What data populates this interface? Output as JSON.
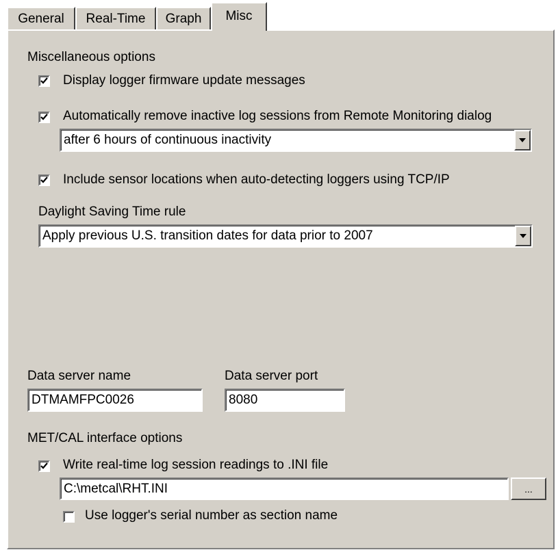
{
  "tabs": [
    {
      "label": "General"
    },
    {
      "label": "Real-Time"
    },
    {
      "label": "Graph"
    },
    {
      "label": "Misc"
    }
  ],
  "misc_group": {
    "title": "Miscellaneous options",
    "firmware_msgs": {
      "label": "Display logger firmware update messages",
      "checked": true
    },
    "auto_remove": {
      "label": "Automatically remove inactive log sessions from Remote Monitoring dialog",
      "checked": true
    },
    "inactivity_select": {
      "value": "after 6 hours of continuous inactivity"
    },
    "sensor_locations": {
      "label": "Include sensor locations when auto-detecting loggers using TCP/IP",
      "checked": true
    }
  },
  "dst": {
    "label": "Daylight Saving Time rule",
    "value": "Apply previous U.S. transition dates for data prior to 2007"
  },
  "server": {
    "name_label": "Data server name",
    "name_value": "DTMAMFPC0026",
    "port_label": "Data server port",
    "port_value": "8080"
  },
  "metcal": {
    "title": "MET/CAL interface options",
    "write_readings": {
      "label": "Write real-time log session readings to .INI file",
      "checked": true
    },
    "ini_path": "C:\\metcal\\RHT.INI",
    "browse_label": "...",
    "serial_section": {
      "label": "Use logger's serial number as section name",
      "checked": false
    }
  },
  "colors": {
    "face": "#d4d0c8",
    "shadow": "#808080",
    "highlight": "#ffffff"
  }
}
